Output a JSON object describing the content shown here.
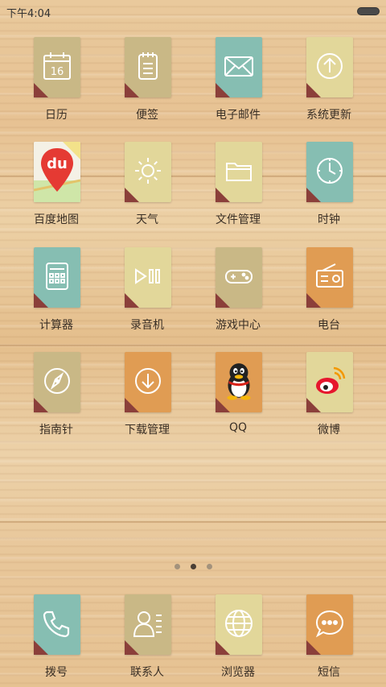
{
  "status_bar": {
    "time": "下午4:04"
  },
  "apps": [
    {
      "id": "calendar",
      "label": "日历",
      "color": "#c9b886",
      "icon": "calendar-icon",
      "date": "16"
    },
    {
      "id": "notes",
      "label": "便签",
      "color": "#c9b886",
      "icon": "notepad-icon"
    },
    {
      "id": "email",
      "label": "电子邮件",
      "color": "#86beb2",
      "icon": "envelope-icon"
    },
    {
      "id": "update",
      "label": "系统更新",
      "color": "#e2d79a",
      "icon": "upload-arrow-icon"
    },
    {
      "id": "baidu-map",
      "label": "百度地图",
      "color": "#ffffff",
      "icon": "baidu-map-icon",
      "brand_text": "du"
    },
    {
      "id": "weather",
      "label": "天气",
      "color": "#e2d79a",
      "icon": "sun-icon"
    },
    {
      "id": "files",
      "label": "文件管理",
      "color": "#e2d79a",
      "icon": "folder-icon"
    },
    {
      "id": "clock",
      "label": "时钟",
      "color": "#86beb2",
      "icon": "clock-icon"
    },
    {
      "id": "calculator",
      "label": "计算器",
      "color": "#86beb2",
      "icon": "calculator-icon"
    },
    {
      "id": "recorder",
      "label": "录音机",
      "color": "#e2d79a",
      "icon": "play-pause-icon"
    },
    {
      "id": "games",
      "label": "游戏中心",
      "color": "#c9b886",
      "icon": "gamepad-icon"
    },
    {
      "id": "radio",
      "label": "电台",
      "color": "#e09c53",
      "icon": "radio-icon"
    },
    {
      "id": "compass",
      "label": "指南针",
      "color": "#c9b886",
      "icon": "compass-icon"
    },
    {
      "id": "downloads",
      "label": "下载管理",
      "color": "#e09c53",
      "icon": "download-arrow-icon"
    },
    {
      "id": "qq",
      "label": "QQ",
      "color": "#e09c53",
      "icon": "qq-penguin-icon"
    },
    {
      "id": "weibo",
      "label": "微博",
      "color": "#e2d79a",
      "icon": "weibo-icon"
    }
  ],
  "page_indicator": {
    "count": 3,
    "active": 1
  },
  "dock": [
    {
      "id": "dialer",
      "label": "拨号",
      "color": "#86beb2",
      "icon": "phone-icon"
    },
    {
      "id": "contacts",
      "label": "联系人",
      "color": "#c9b886",
      "icon": "contacts-icon"
    },
    {
      "id": "browser",
      "label": "浏览器",
      "color": "#e2d79a",
      "icon": "globe-icon"
    },
    {
      "id": "sms",
      "label": "短信",
      "color": "#e09c53",
      "icon": "chat-bubble-icon"
    }
  ]
}
